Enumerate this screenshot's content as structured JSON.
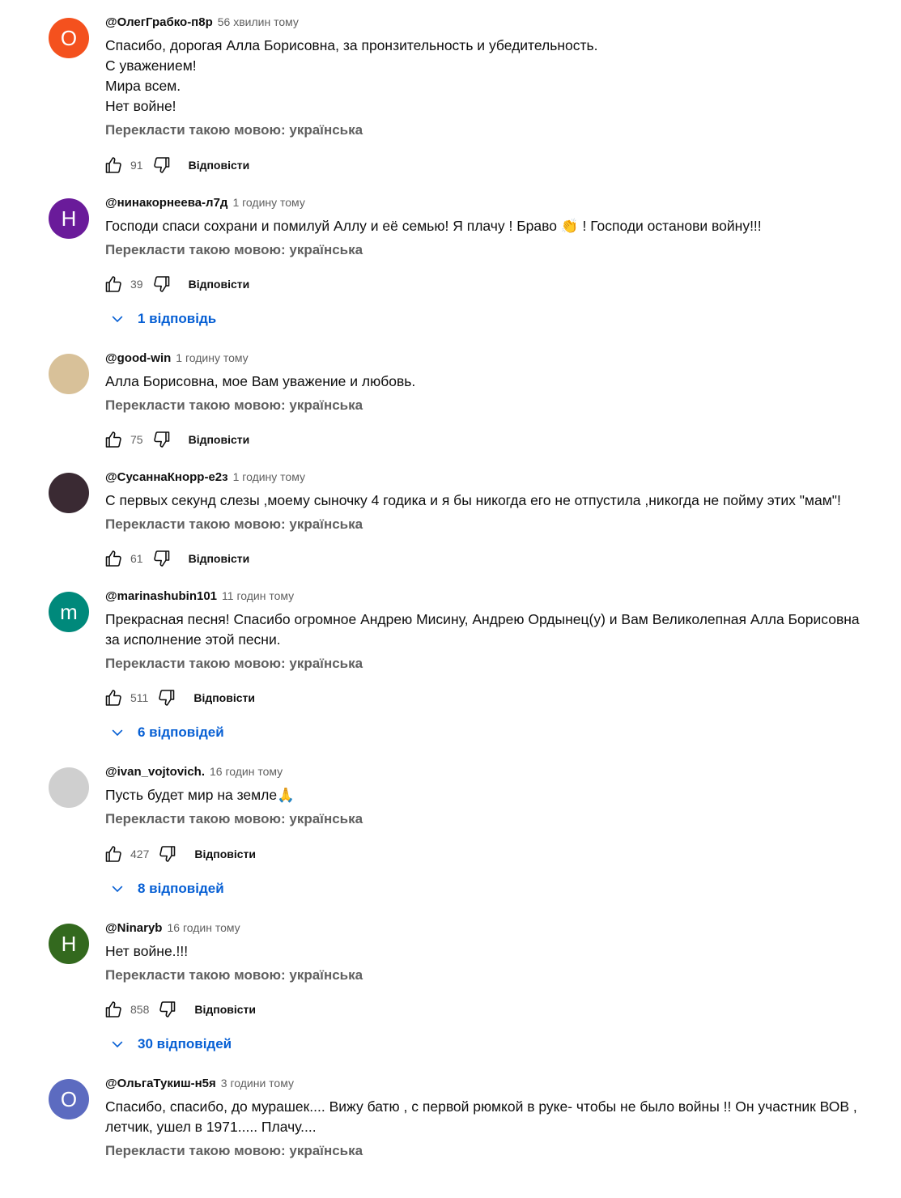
{
  "translate_label": "Перекласти такою мовою: українська",
  "reply_label": "Відповісти",
  "icons": {
    "like": "thumb-up-icon",
    "dislike": "thumb-down-icon",
    "expand": "chevron-down-icon"
  },
  "colors": {
    "link": "#065fd4",
    "secondary": "#606060"
  },
  "comments": [
    {
      "avatar_letter": "О",
      "avatar_color": "#f4511e",
      "author": "@ОлегГрабко-п8р",
      "time": "56 хвилин тому",
      "text": "Спасибо, дорогая Алла Борисовна, за пронзительность и убедительность.\nС уважением!\nМира всем.\nНет войне!",
      "likes": "91"
    },
    {
      "avatar_letter": "Н",
      "avatar_color": "#6a1b9a",
      "author": "@нинакорнеева-л7д",
      "time": "1 годину тому",
      "text": "Господи спаси сохрани и помилуй Аллу  и её семью! Я плачу ! Браво 👏 ! Господи останови войну!!!",
      "likes": "39",
      "replies": "1 відповідь"
    },
    {
      "avatar_letter": "",
      "avatar_color": "#d8c199",
      "author": "@good-win",
      "time": "1 годину тому",
      "text": "Алла Борисовна, мое Вам уважение и любовь.",
      "likes": "75"
    },
    {
      "avatar_letter": "",
      "avatar_color": "#3a2a33",
      "author": "@СусаннаКнорр-е2з",
      "time": "1 годину тому",
      "text": "С первых секунд слезы ,моему сыночку 4 годика и я бы никогда его не отпустила ,никогда не пойму этих \"мам\"!",
      "likes": "61"
    },
    {
      "avatar_letter": "m",
      "avatar_color": "#00897b",
      "author": "@marinashubin101",
      "time": "11 годин тому",
      "text": "Прекрасная песня! Спасибо огромное Андрею Мисину, Андрею Ордынец(у) и Вам  Великолепная Алла Борисовна  за исполнение  этой  песни.",
      "likes": "511",
      "replies": "6 відповідей"
    },
    {
      "avatar_letter": "",
      "avatar_color": "#cfcfcf",
      "author": "@ivan_vojtovich.",
      "time": "16 годин тому",
      "text": "Пусть будет мир на земле🙏",
      "likes": "427",
      "replies": "8 відповідей"
    },
    {
      "avatar_letter": "Н",
      "avatar_color": "#33691e",
      "author": "@Ninaryb",
      "time": "16 годин тому",
      "text": "Нет войне.!!!",
      "likes": "858",
      "replies": "30 відповідей"
    },
    {
      "avatar_letter": "О",
      "avatar_color": "#5c6bc0",
      "author": "@ОльгаТукиш-н5я",
      "time": "3 години тому",
      "text": "Спасибо, спасибо, до мурашек.... Вижу батю , с первой рюмкой в руке- чтобы не было войны !! Он участник ВОВ , летчик, ушел в 1971..... Плачу....",
      "likes": ""
    }
  ]
}
